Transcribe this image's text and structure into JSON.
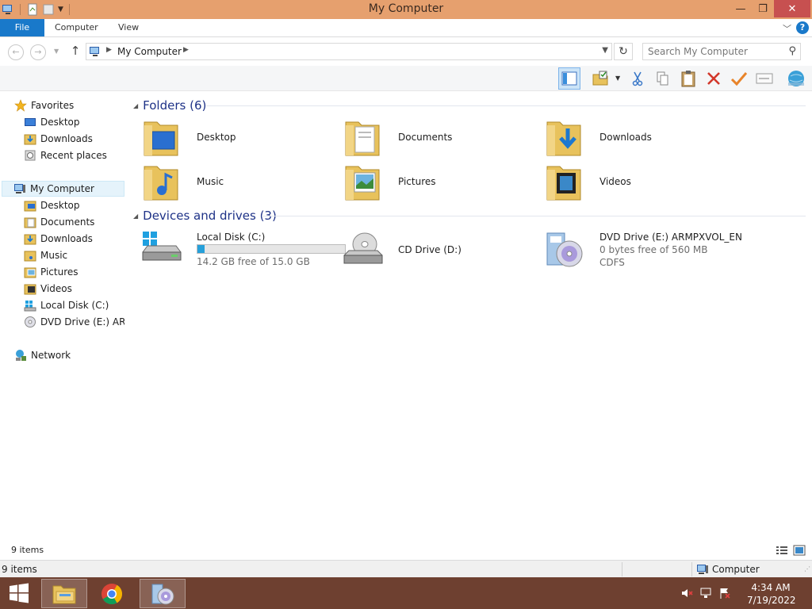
{
  "window": {
    "title": "My Computer",
    "controls": {
      "minimize": "—",
      "maximize": "❐",
      "close": "✕"
    }
  },
  "ribbon": {
    "tabs": [
      {
        "label": "File"
      },
      {
        "label": "Computer"
      },
      {
        "label": "View"
      }
    ]
  },
  "address": {
    "crumb": "My Computer",
    "search_placeholder": "Search My Computer"
  },
  "sidebar": {
    "favorites": {
      "label": "Favorites",
      "items": [
        {
          "label": "Desktop"
        },
        {
          "label": "Downloads"
        },
        {
          "label": "Recent places"
        }
      ]
    },
    "computer": {
      "label": "My Computer",
      "items": [
        {
          "label": "Desktop"
        },
        {
          "label": "Documents"
        },
        {
          "label": "Downloads"
        },
        {
          "label": "Music"
        },
        {
          "label": "Pictures"
        },
        {
          "label": "Videos"
        },
        {
          "label": "Local Disk (C:)"
        },
        {
          "label": "DVD Drive (E:) ARMPXVOL_EN"
        }
      ]
    },
    "network": {
      "label": "Network"
    }
  },
  "content": {
    "folders_header": "Folders (6)",
    "folders": [
      {
        "label": "Desktop",
        "icon": "desktop-folder-icon"
      },
      {
        "label": "Documents",
        "icon": "documents-folder-icon"
      },
      {
        "label": "Downloads",
        "icon": "downloads-folder-icon"
      },
      {
        "label": "Music",
        "icon": "music-folder-icon"
      },
      {
        "label": "Pictures",
        "icon": "pictures-folder-icon"
      },
      {
        "label": "Videos",
        "icon": "videos-folder-icon"
      }
    ],
    "drives_header": "Devices and drives (3)",
    "drives": [
      {
        "label": "Local Disk (C:)",
        "free": "14.2 GB free of 15.0 GB",
        "used_fraction": 0.05
      },
      {
        "label": "CD Drive (D:)"
      },
      {
        "label": "DVD Drive (E:) ARMPXVOL_EN",
        "free": "0 bytes free of 560 MB",
        "fs": "CDFS"
      }
    ]
  },
  "status": {
    "items_count": "9 items",
    "bottom_items_count": "9 items",
    "location": "Computer"
  },
  "taskbar": {
    "time": "4:34 AM",
    "date": "7/19/2022"
  },
  "colors": {
    "title_bar": "#e6a06e",
    "file_tab": "#1979ca",
    "taskbar": "#6e4030",
    "group_header": "#1e3287",
    "capacity_fill": "#26a0da"
  }
}
